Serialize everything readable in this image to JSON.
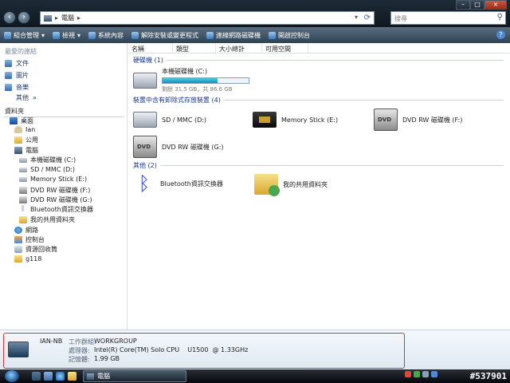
{
  "address": {
    "root_arrow": "▸",
    "location": "電腦",
    "arrow": "▸"
  },
  "search": {
    "placeholder": "搜尋"
  },
  "toolbar": [
    {
      "label": "組合管理",
      "arrow": "▾"
    },
    {
      "label": "檢視",
      "arrow": "▾"
    },
    {
      "label": "系統內容"
    },
    {
      "label": "解除安裝或變更程式"
    },
    {
      "label": "連線網路磁碟機"
    },
    {
      "label": "開啟控制台"
    }
  ],
  "nav": {
    "favorites_title": "最愛的連結",
    "favorites": [
      "文件",
      "圖片",
      "音樂"
    ],
    "more": "其他",
    "more_chevron": "»",
    "folders_title": "資料夾",
    "folders_chevron": "▾",
    "tree": [
      "桌面",
      "Ian",
      "公用",
      "電腦",
      "本機磁碟機 (C:)",
      "SD / MMC (D:)",
      "Memory Stick (E:)",
      "DVD RW 磁碟機 (F:)",
      "DVD RW 磁碟機 (G:)",
      "Bluetooth資訊交換器",
      "我的共用資料夾",
      "網路",
      "控制台",
      "資源回收筒",
      "g118"
    ]
  },
  "columns": [
    "名稱",
    "類型",
    "大小總計",
    "可用空間"
  ],
  "groups": {
    "hdd": "硬碟機 (1)",
    "removable": "裝置中含有卸除式存放裝置 (4)",
    "other": "其他 (2)"
  },
  "drive_c": {
    "label": "本機磁碟機 (C:)",
    "free_text": "剩餘 31.5 GB，共 86.6 GB",
    "used_fraction": 0.64
  },
  "removable": [
    "SD / MMC (D:)",
    "Memory Stick (E:)",
    "DVD RW 磁碟機 (F:)",
    "DVD RW 磁碟機 (G:)"
  ],
  "dvd_badge": "DVD",
  "other": [
    "Bluetooth資訊交換器",
    "我的共用資料夾"
  ],
  "details": {
    "computer_name": "IAN-NB",
    "workgroup_label": "工作群組:",
    "workgroup": "WORKGROUP",
    "cpu_label": "處理器:",
    "cpu": "Intel(R) Core(TM) Solo CPU    U1500  @ 1.33GHz",
    "memory_label": "記憶體:",
    "memory": "1.99 GB"
  },
  "taskbar": {
    "task_label": "電腦",
    "watermark": "#537901"
  },
  "window_buttons": {
    "minimize": "–",
    "maximize": "□",
    "close": "×"
  }
}
